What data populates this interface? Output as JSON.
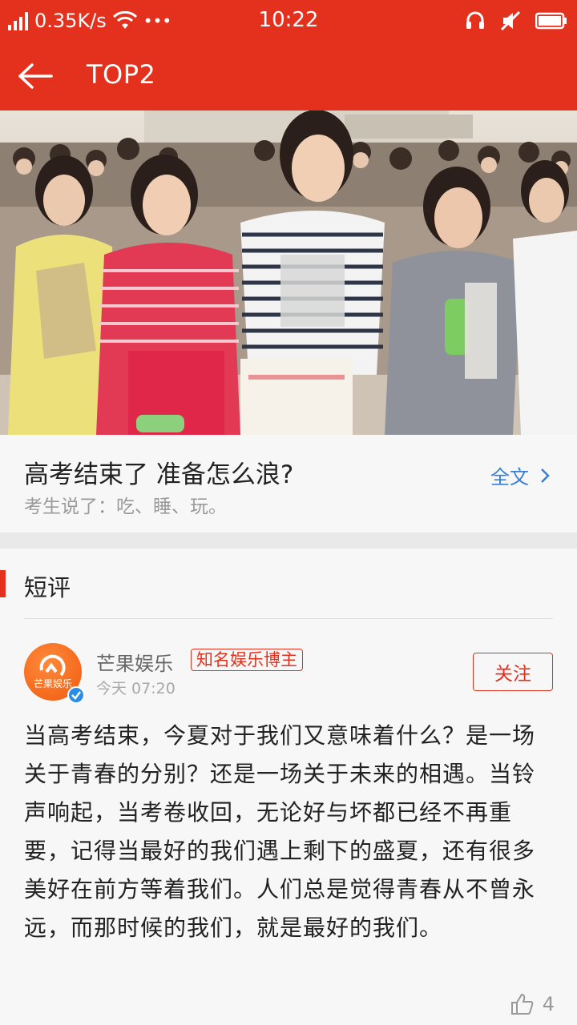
{
  "status_bar": {
    "net_speed": "0.35K/s",
    "more": "•••",
    "time": "10:22"
  },
  "app_bar": {
    "title": "TOP2"
  },
  "article": {
    "title": "高考结束了 准备怎么浪?",
    "subtitle": "考生说了：吃、睡、玩。",
    "full_text_link": "全文"
  },
  "section": {
    "title": "短评"
  },
  "comment": {
    "avatar_text": "芒果娱乐",
    "author": "芒果娱乐",
    "tag": "知名娱乐博主",
    "time": "今天 07:20",
    "follow_label": "关注",
    "body": "当高考结束，今夏对于我们又意味着什么？是一场关于青春的分别？还是一场关于未来的相遇。当铃声响起，当考卷收回，无论好与坏都已经不再重要，记得当最好的我们遇上剩下的盛夏，还有很多美好在前方等着我们。人们总是觉得青春从不曾永远，而那时候的我们，就是最好的我们。",
    "likes": "4"
  },
  "colors": {
    "accent": "#e4311d",
    "link": "#3a7fd4"
  }
}
